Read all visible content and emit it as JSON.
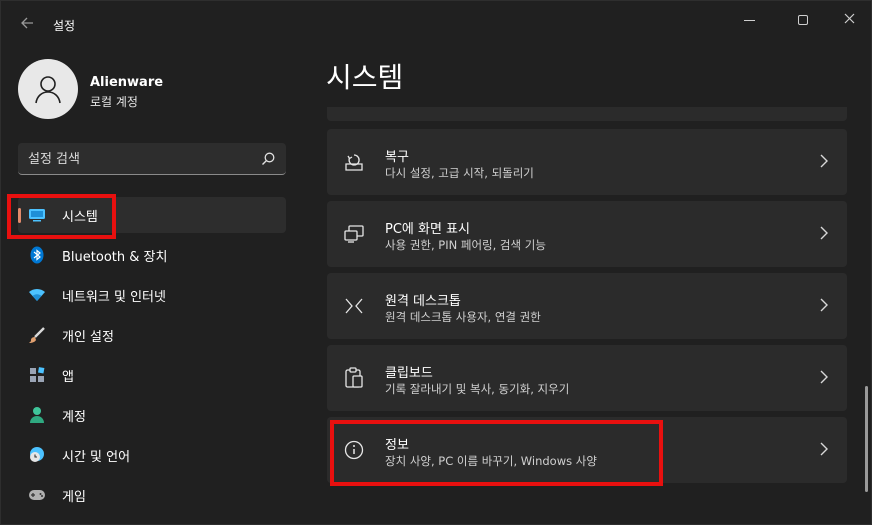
{
  "window": {
    "app_title": "설정",
    "back_icon": "back-arrow-icon",
    "controls": [
      "minimize-icon",
      "maximize-icon",
      "close-icon"
    ]
  },
  "profile": {
    "name": "Alienware",
    "account_type": "로컬 계정",
    "avatar_icon": "person-icon"
  },
  "search": {
    "placeholder": "설정 검색",
    "icon": "search-icon"
  },
  "sidebar": {
    "items": [
      {
        "label": "시스템",
        "icon": "monitor-icon",
        "active": true,
        "icon_color": "#4cc2ff"
      },
      {
        "label": "Bluetooth & 장치",
        "icon": "bluetooth-icon",
        "active": false,
        "icon_color": "#0078d4"
      },
      {
        "label": "네트워크 및 인터넷",
        "icon": "wifi-icon",
        "active": false,
        "icon_color": "#4cc2ff"
      },
      {
        "label": "개인 설정",
        "icon": "brush-icon",
        "active": false,
        "icon_color": "#e0a070"
      },
      {
        "label": "앱",
        "icon": "apps-icon",
        "active": false,
        "icon_color": "#9aa4b5"
      },
      {
        "label": "계정",
        "icon": "account-icon",
        "active": false,
        "icon_color": "#3fc59a"
      },
      {
        "label": "시간 및 언어",
        "icon": "clock-globe-icon",
        "active": false,
        "icon_color": "#4cc2ff"
      },
      {
        "label": "게임",
        "icon": "gamepad-icon",
        "active": false,
        "icon_color": "#b0b0b0"
      }
    ]
  },
  "main": {
    "title": "시스템",
    "cards": [
      {
        "title": "복구",
        "subtitle": "다시 설정, 고급 시작, 되돌리기",
        "icon": "recovery-icon"
      },
      {
        "title": "PC에 화면 표시",
        "subtitle": "사용 권한, PIN 페어링, 검색 기능",
        "icon": "project-screen-icon"
      },
      {
        "title": "원격 데스크톱",
        "subtitle": "원격 데스크톱 사용자, 연결 권한",
        "icon": "remote-desktop-icon"
      },
      {
        "title": "클립보드",
        "subtitle": "기록 잘라내기 및 복사, 동기화, 지우기",
        "icon": "clipboard-icon"
      },
      {
        "title": "정보",
        "subtitle": "장치 사양, PC 이름 바꾸기, Windows 사양",
        "icon": "info-icon"
      }
    ]
  },
  "colors": {
    "background": "#202020",
    "card": "#2b2b2b",
    "accent_indicator": "#e28a6b",
    "highlight_box": "#e8100f"
  }
}
